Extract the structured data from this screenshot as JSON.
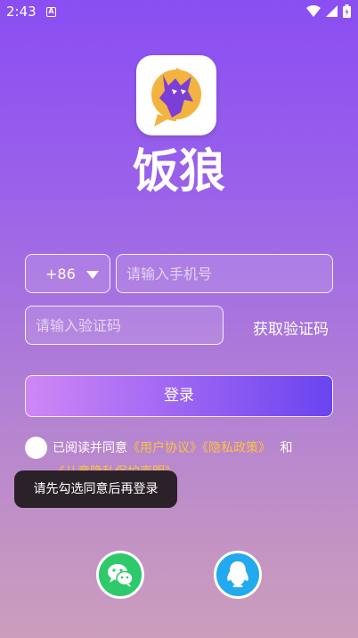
{
  "status_bar": {
    "time": "2:43",
    "notification_letter": "A"
  },
  "app": {
    "name": "饭狼"
  },
  "form": {
    "country_code": "+86",
    "phone_placeholder": "请输入手机号",
    "code_placeholder": "请输入验证码",
    "get_code_label": "获取验证码",
    "login_label": "登录"
  },
  "agreement": {
    "prefix": "已阅读并同意",
    "user_agreement": "《用户协议》",
    "privacy_policy": "《隐私政策》",
    "and": "和",
    "child_privacy": "《儿童隐私保护声明》"
  },
  "toast": {
    "message": "请先勾选同意后再登录"
  },
  "social": {
    "icons": [
      "wechat-icon",
      "qq-icon"
    ]
  },
  "colors": {
    "accent_link": "#f7c43f",
    "login_start": "#cf87f5",
    "login_end": "#6a44f0",
    "wechat": "#2dc96a",
    "qq": "#22a9ee"
  }
}
